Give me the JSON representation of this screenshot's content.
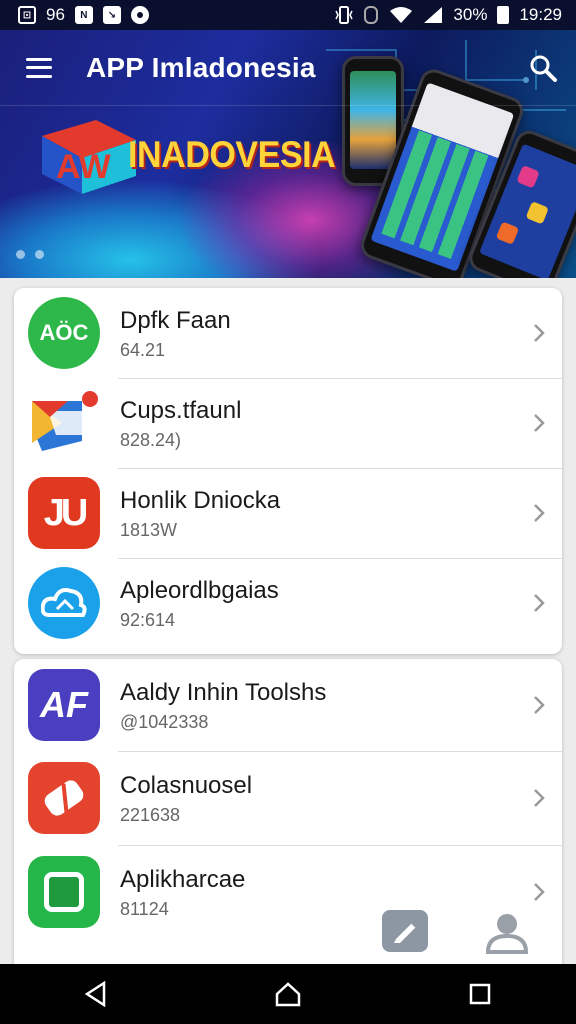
{
  "status_bar": {
    "notif_count": "96",
    "battery": "30%",
    "time": "19:29"
  },
  "header": {
    "title": "APP Imladonesia",
    "banner_text": "INADOVESIA",
    "brand_red": "#d9342b",
    "brand_yellow": "#ffd43b"
  },
  "list1": [
    {
      "name": "Dpfk Faan",
      "meta": "64.21",
      "icon": "aoc-icon",
      "color": "#2eb84a"
    },
    {
      "name": "Cups.tfaunl",
      "meta": "828.24)",
      "icon": "mail-arrow-icon",
      "color": "#2b76d6"
    },
    {
      "name": "Honlik Dniocka",
      "meta": "1813W",
      "icon": "ju-icon",
      "color": "#e0391f"
    },
    {
      "name": "Apleordlbgaias",
      "meta": "92:614",
      "icon": "cloud-icon",
      "color": "#1aa1ea"
    }
  ],
  "list2": [
    {
      "name": "Aaldy Inhin Toolshs",
      "meta": "@1042338",
      "icon": "af-icon",
      "color": "#4a3fc0"
    },
    {
      "name": "Colasnuosel",
      "meta": "221638",
      "icon": "eraser-icon",
      "color": "#e4432e"
    },
    {
      "name": "Aplikharcae",
      "meta": "81124",
      "icon": "square-app-icon",
      "color": "#25b64a"
    }
  ]
}
